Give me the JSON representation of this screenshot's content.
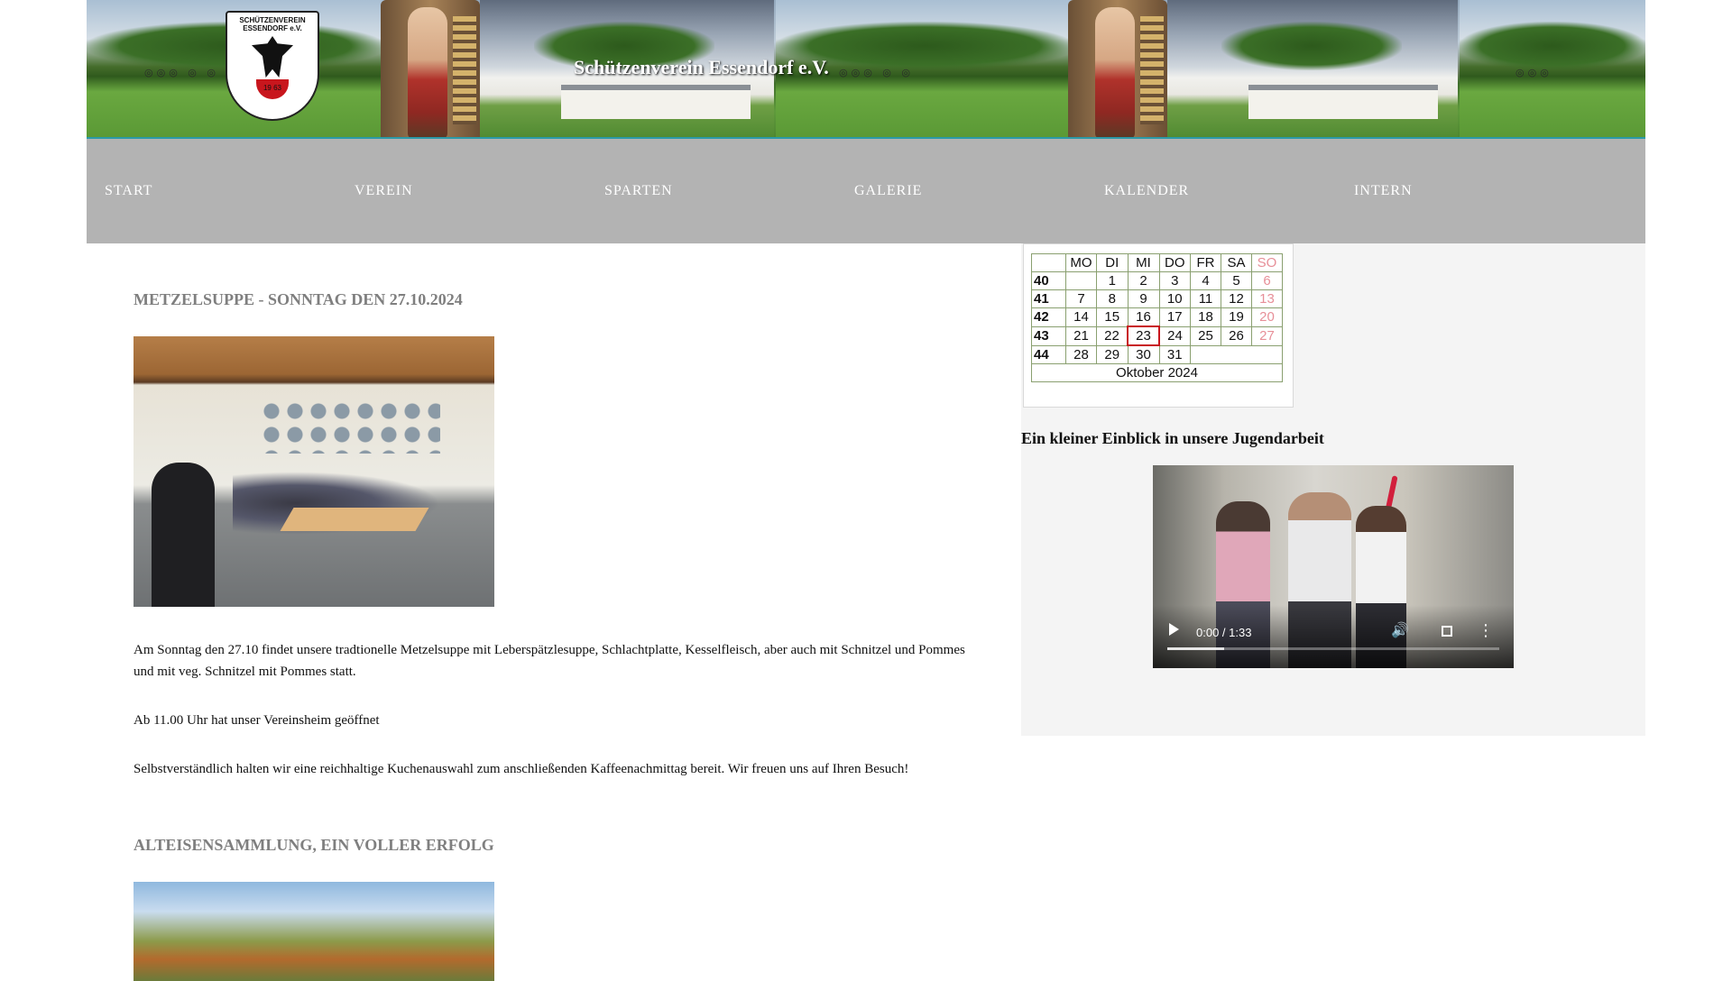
{
  "header": {
    "site_title": "Schützenverein Essendorf  e.V.",
    "logo_text": "SCHÜTZENVEREIN ESSENDORF e.V.",
    "logo_year": "19   63"
  },
  "nav": {
    "items": [
      {
        "label": "START"
      },
      {
        "label": "VEREIN"
      },
      {
        "label": "SPARTEN"
      },
      {
        "label": "GALERIE"
      },
      {
        "label": "KALENDER"
      },
      {
        "label": "INTERN"
      }
    ]
  },
  "main": {
    "articles": [
      {
        "title": "METZELSUPPE - SONNTAG DEN 27.10.2024",
        "paragraphs": [
          "Am Sonntag den 27.10 findet unsere tradtionelle Metzelsuppe mit Leberspätzlesuppe, Schlachtplatte, Kesselfleisch, aber auch mit Schnitzel und Pommes und mit veg. Schnitzel mit Pommes statt.",
          "Ab 11.00 Uhr hat unser Vereinsheim geöffnet",
          "Selbstverständlich halten wir eine reichhaltige Kuchenauswahl zum anschließenden Kaffeenachmittag bereit. Wir freuen uns auf Ihren Besuch!"
        ]
      },
      {
        "title": "ALTEISENSAMMLUNG, EIN VOLLER ERFOLG"
      }
    ]
  },
  "calendar": {
    "headers": [
      "MO",
      "DI",
      "MI",
      "DO",
      "FR",
      "SA",
      "SO"
    ],
    "weeks": [
      {
        "wk": "40",
        "days": [
          "",
          "1",
          "2",
          "3",
          "4",
          "5",
          "6"
        ]
      },
      {
        "wk": "41",
        "days": [
          "7",
          "8",
          "9",
          "10",
          "11",
          "12",
          "13"
        ]
      },
      {
        "wk": "42",
        "days": [
          "14",
          "15",
          "16",
          "17",
          "18",
          "19",
          "20"
        ]
      },
      {
        "wk": "43",
        "days": [
          "21",
          "22",
          "23",
          "24",
          "25",
          "26",
          "27"
        ]
      },
      {
        "wk": "44",
        "days": [
          "28",
          "29",
          "30",
          "31",
          "",
          "",
          ""
        ]
      }
    ],
    "month_label": "Oktober 2024",
    "today": "23",
    "sunday_color": "#e78f98",
    "today_border_color": "#c8161d"
  },
  "sidebar": {
    "heading": "Ein kleiner Einblick in unsere Jugendarbeit",
    "video": {
      "time": "0:00 / 1:33",
      "buffered_fraction": 0.17
    }
  },
  "colors": {
    "nav_bg": "#b3b3b3",
    "article_title": "#7f7f7f",
    "sidebar_bg": "#f4f4f4",
    "banner_line": "#2b9aa8"
  }
}
